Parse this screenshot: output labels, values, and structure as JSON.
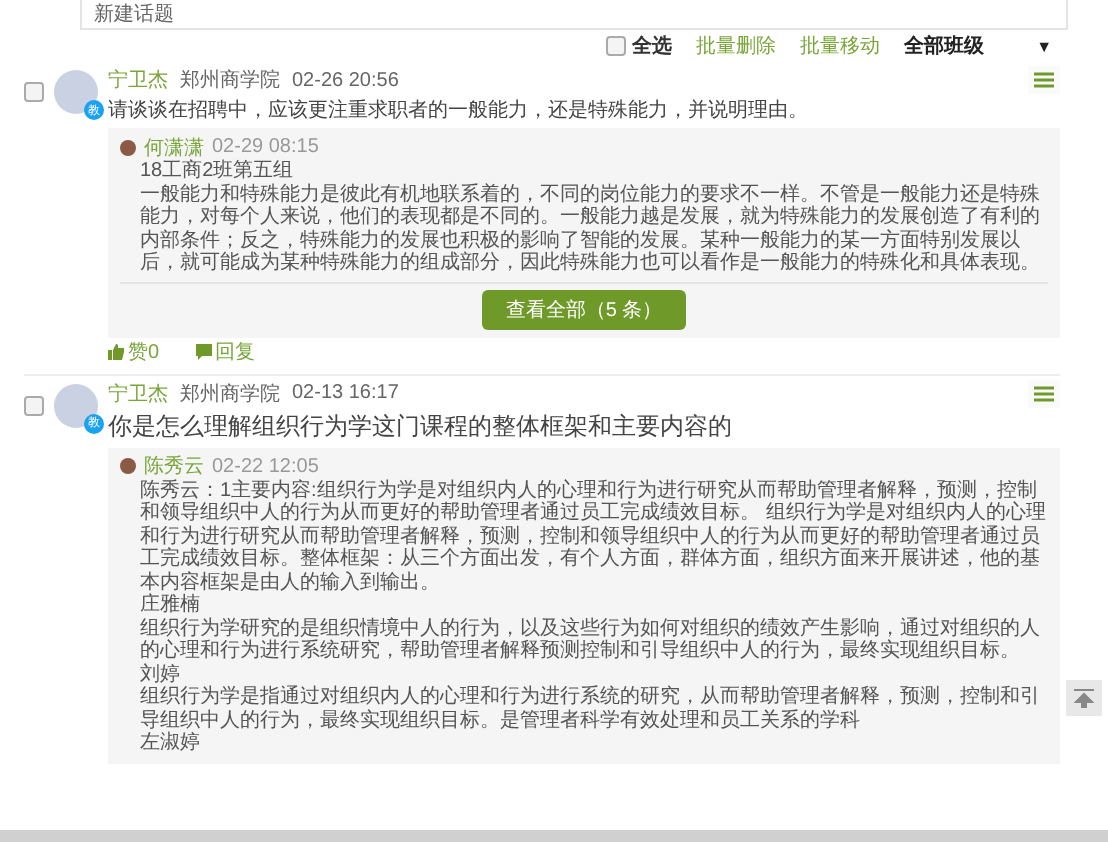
{
  "new_topic": {
    "placeholder": "新建话题"
  },
  "toolbar": {
    "select_all": {
      "label": "全选",
      "checked": false
    },
    "actions": [
      "批量删除",
      "批量移动"
    ],
    "class_filter": "全部班级",
    "caret": "▼"
  },
  "posts": [
    {
      "selected": false,
      "kind": "plain",
      "author": "宁卫杰",
      "school": "郑州商学院",
      "time": "02-26 20:56",
      "badge": "教",
      "body": "请谈谈在招聘中，应该更注重求职者的一般能力，还是特殊能力，并说明理由。",
      "replies": [
        {
          "name": "何潇潇",
          "time": "02-29 08:15",
          "lines": [
            "18工商2班第五组",
            "一般能力和特殊能力是彼此有机地联系着的，不同的岗位能力的要求不一样。不管是一般能力还是特殊能力，对每个人来说，他们的表现都是不同的。一般能力越是发展，就为特殊能力的发展创造了有利的内部条件；反之，特殊能力的发展也积极的影响了智能的发展。某种一般能力的某一方面特别发展以后，就可能成为某种特殊能力的组成部分，因此特殊能力也可以看作是一般能力的特殊化和具体表现。"
          ]
        }
      ],
      "view_all": "查看全部（5 条）",
      "like": "赞0",
      "reply": "回复"
    },
    {
      "selected": false,
      "kind": "heading",
      "author": "宁卫杰",
      "school": "郑州商学院",
      "time": "02-13 16:17",
      "badge": "教",
      "body": "你是怎么理解组织行为学这门课程的整体框架和主要内容的",
      "replies": [
        {
          "name": "陈秀云",
          "time": "02-22 12:05",
          "lines": [
            "陈秀云：1主要内容:组织行为学是对组织内人的心理和行为进行研究从而帮助管理者解释，预测，控制和领导组织中人的行为从而更好的帮助管理者通过员工完成绩效目标。 组织行为学是对组织内人的心理和行为进行研究从而帮助管理者解释，预测，控制和领导组织中人的行为从而更好的帮助管理者通过员工完成绩效目标。整体框架：从三个方面出发，有个人方面，群体方面，组织方面来开展讲述，他的基本内容框架是由人的输入到输出。",
            "庄雅楠",
            "组织行为学研究的是组织情境中人的行为，以及这些行为如何对组织的绩效产生影响，通过对组织的人的心理和行为进行系统研究，帮助管理者解释预测控制和引导组织中人的行为，最终实现组织目标。",
            "刘婷",
            "组织行为学是指通过对组织内人的心理和行为进行系统的研究，从而帮助管理者解释，预测，控制和引导组织中人的行为，最终实现组织目标。是管理者科学有效处理和员工关系的学科",
            "左淑婷"
          ]
        }
      ]
    }
  ]
}
